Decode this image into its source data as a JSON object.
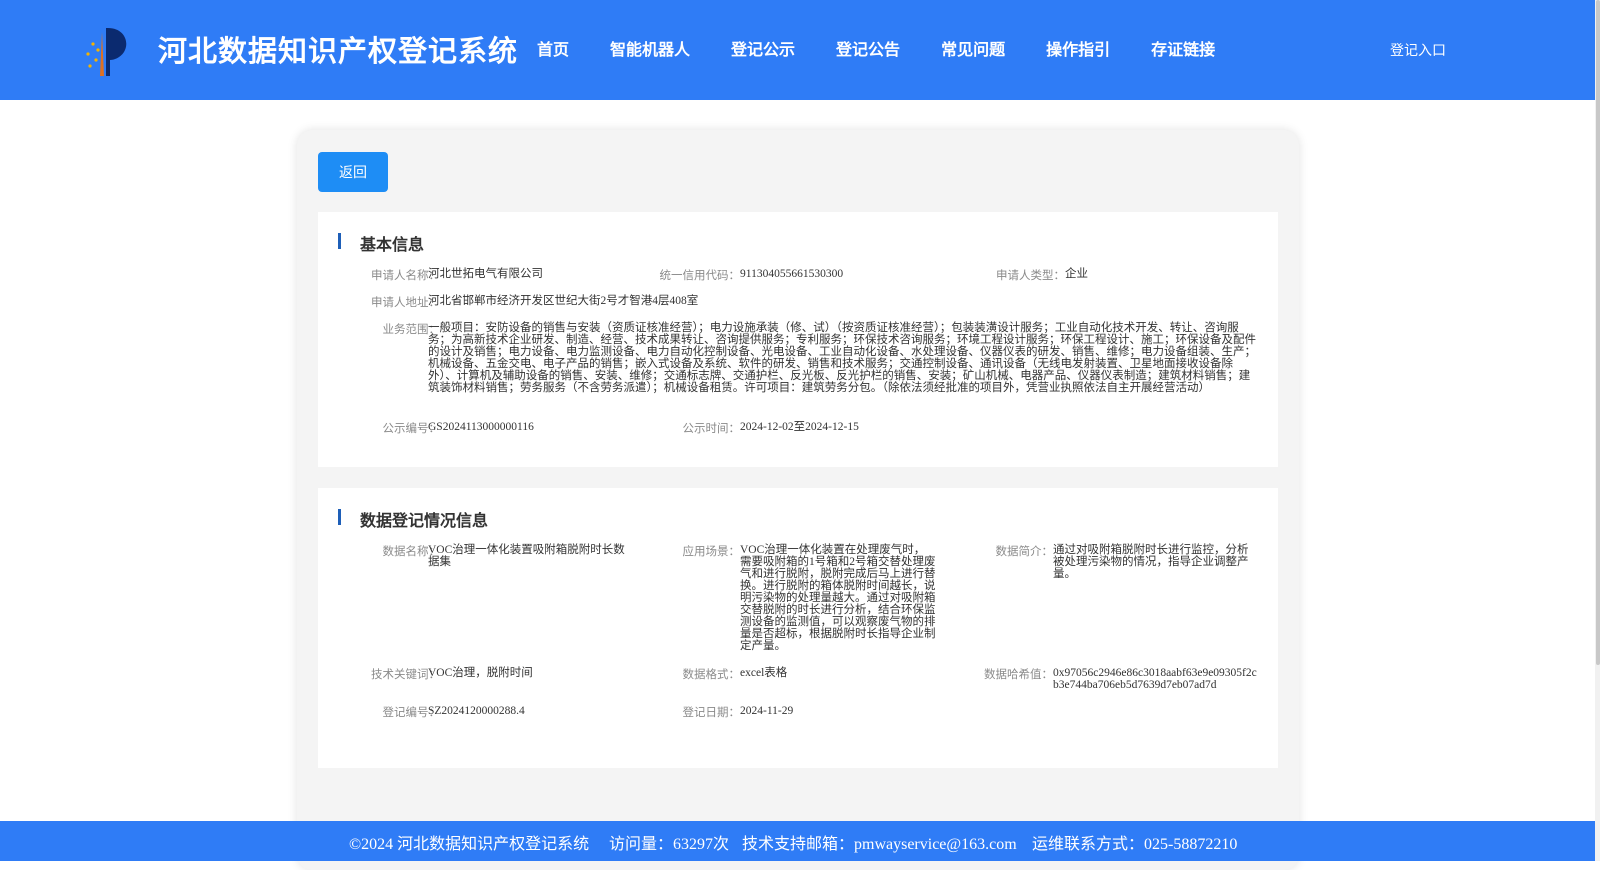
{
  "header": {
    "site_title": "河北数据知识产权登记系统",
    "nav": [
      "首页",
      "智能机器人",
      "登记公示",
      "登记公告",
      "常见问题",
      "操作指引",
      "存证链接"
    ],
    "login": "登记入口"
  },
  "back_button": "返回",
  "basic": {
    "title": "基本信息",
    "applicant_name_label": "申请人名称：",
    "applicant_name": "河北世拓电气有限公司",
    "credit_code_label": "统一信用代码：",
    "credit_code": "911304055661530300",
    "applicant_type_label": "申请人类型：",
    "applicant_type": "企业",
    "address_label": "申请人地址：",
    "address": "河北省邯郸市经济开发区世纪大街2号才智港4层408室",
    "scope_label": "业务范围：",
    "scope": "一般项目：安防设备的销售与安装（资质证核准经营）；电力设施承装（修、试）（按资质证核准经营）；包装装潢设计服务；工业自动化技术开发、转让、咨询服务；为高新技术企业研发、制造、经营、技术成果转让、咨询提供服务；专利服务；环保技术咨询服务；环境工程设计服务；环保工程设计、施工；环保设备及配件的设计及销售；电力设备、电力监测设备、电力自动化控制设备、光电设备、工业自动化设备、水处理设备、仪器仪表的研发、销售、维修；电力设备组装、生产；机械设备、五金交电、电子产品的销售；嵌入式设备及系统、软件的研发、销售和技术服务；交通控制设备、通讯设备（无线电发射装置、卫星地面接收设备除外）、计算机及辅助设备的销售、安装、维修；交通标志牌、交通护栏、反光板、反光护栏的销售、安装；矿山机械、电器产品、仪器仪表制造；建筑材料销售；建筑装饰材料销售；劳务服务（不含劳务派遣）；机械设备租赁。许可项目：建筑劳务分包。（除依法须经批准的项目外，凭营业执照依法自主开展经营活动）",
    "pub_no_label": "公示编号：",
    "pub_no": "GS2024113000000116",
    "pub_time_label": "公示时间：",
    "pub_time": "2024-12-02至2024-12-15"
  },
  "registration": {
    "title": "数据登记情况信息",
    "data_name_label": "数据名称：",
    "data_name": "VOC治理一体化装置吸附箱脱附时长数据集",
    "scene_label": "应用场景：",
    "scene": "VOC治理一体化装置在处理废气时，需要吸附箱的1号箱和2号箱交替处理废气和进行脱附，脱附完成后马上进行替换。进行脱附的箱体脱附时间越长，说明污染物的处理量越大。通过对吸附箱交替脱附的时长进行分析，结合环保监测设备的监测值，可以观察废气物的排量是否超标，根据脱附时长指导企业制定产量。",
    "intro_label": "数据简介：",
    "intro": "通过对吸附箱脱附时长进行监控，分析被处理污染物的情况，指导企业调整产量。",
    "keywords_label": "技术关键词：",
    "keywords": "VOC治理，脱附时间",
    "format_label": "数据格式：",
    "format": "excel表格",
    "hash_label": "数据哈希值：",
    "hash": "0x97056c2946e86c3018aabf63e9e09305f2cb3e744ba706eb5d7639d7eb07ad7d",
    "reg_no_label": "登记编号：",
    "reg_no": "SZ2024120000288.4",
    "reg_date_label": "登记日期：",
    "reg_date": "2024-11-29"
  },
  "footer": {
    "copyright": "©2024 河北数据知识产权登记系统",
    "visits": "访问量：63297次",
    "email": "技术支持邮箱：pmwayservice@163.com",
    "phone": "运维联系方式：025-58872210"
  }
}
